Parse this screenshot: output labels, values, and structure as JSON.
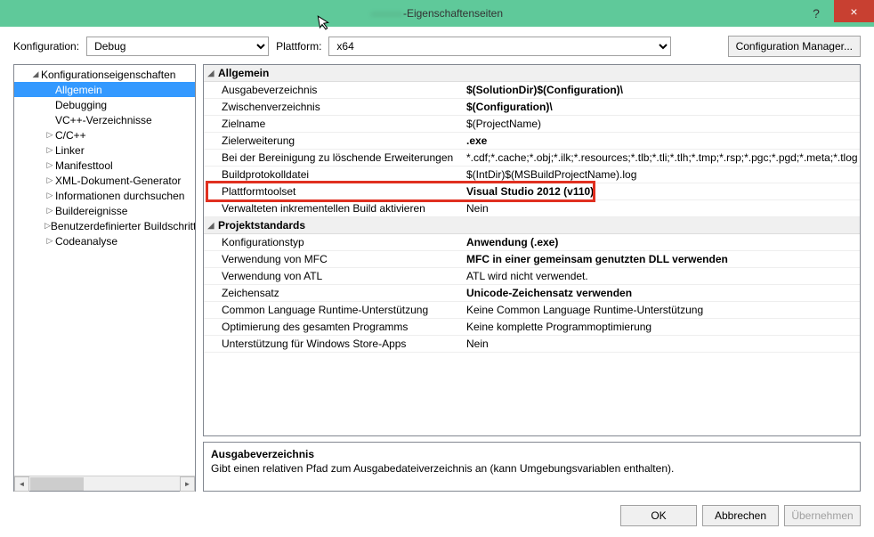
{
  "window": {
    "title_prefix": "———",
    "title_suffix": "-Eigenschaftenseiten",
    "help": "?",
    "close": "×"
  },
  "toolbar": {
    "config_label": "Konfiguration:",
    "config_value": "Debug",
    "platform_label": "Plattform:",
    "platform_value": "x64",
    "config_manager": "Configuration Manager..."
  },
  "tree": {
    "root": "Konfigurationseigenschaften",
    "items": [
      {
        "label": "Allgemein",
        "selected": true
      },
      {
        "label": "Debugging"
      },
      {
        "label": "VC++-Verzeichnisse"
      },
      {
        "label": "C/C++",
        "expandable": true
      },
      {
        "label": "Linker",
        "expandable": true
      },
      {
        "label": "Manifesttool",
        "expandable": true
      },
      {
        "label": "XML-Dokument-Generator",
        "expandable": true
      },
      {
        "label": "Informationen durchsuchen",
        "expandable": true
      },
      {
        "label": "Buildereignisse",
        "expandable": true
      },
      {
        "label": "Benutzerdefinierter Buildschritt",
        "expandable": true
      },
      {
        "label": "Codeanalyse",
        "expandable": true
      }
    ]
  },
  "grid": {
    "sections": [
      {
        "title": "Allgemein",
        "rows": [
          {
            "name": "Ausgabeverzeichnis",
            "value": "$(SolutionDir)$(Configuration)\\",
            "bold": true
          },
          {
            "name": "Zwischenverzeichnis",
            "value": "$(Configuration)\\",
            "bold": true
          },
          {
            "name": "Zielname",
            "value": "$(ProjectName)"
          },
          {
            "name": "Zielerweiterung",
            "value": ".exe",
            "bold": true
          },
          {
            "name": "Bei der Bereinigung zu löschende Erweiterungen",
            "value": "*.cdf;*.cache;*.obj;*.ilk;*.resources;*.tlb;*.tli;*.tlh;*.tmp;*.rsp;*.pgc;*.pgd;*.meta;*.tlog"
          },
          {
            "name": "Buildprotokolldatei",
            "value": "$(IntDir)$(MSBuildProjectName).log"
          },
          {
            "name": "Plattformtoolset",
            "value": "Visual Studio 2012 (v110)",
            "bold": true,
            "highlight": true
          },
          {
            "name": "Verwalteten inkrementellen Build aktivieren",
            "value": "Nein"
          }
        ]
      },
      {
        "title": "Projektstandards",
        "rows": [
          {
            "name": "Konfigurationstyp",
            "value": "Anwendung (.exe)",
            "bold": true
          },
          {
            "name": "Verwendung von MFC",
            "value": "MFC in einer gemeinsam genutzten DLL verwenden",
            "bold": true
          },
          {
            "name": "Verwendung von ATL",
            "value": "ATL wird nicht verwendet."
          },
          {
            "name": "Zeichensatz",
            "value": "Unicode-Zeichensatz verwenden",
            "bold": true
          },
          {
            "name": "Common Language Runtime-Unterstützung",
            "value": "Keine Common Language Runtime-Unterstützung"
          },
          {
            "name": "Optimierung des gesamten Programms",
            "value": "Keine komplette Programmoptimierung"
          },
          {
            "name": "Unterstützung für Windows Store-Apps",
            "value": "Nein"
          }
        ]
      }
    ]
  },
  "description": {
    "title": "Ausgabeverzeichnis",
    "text": "Gibt einen relativen Pfad zum Ausgabedateiverzeichnis an (kann Umgebungsvariablen enthalten)."
  },
  "footer": {
    "ok": "OK",
    "cancel": "Abbrechen",
    "apply": "Übernehmen"
  }
}
